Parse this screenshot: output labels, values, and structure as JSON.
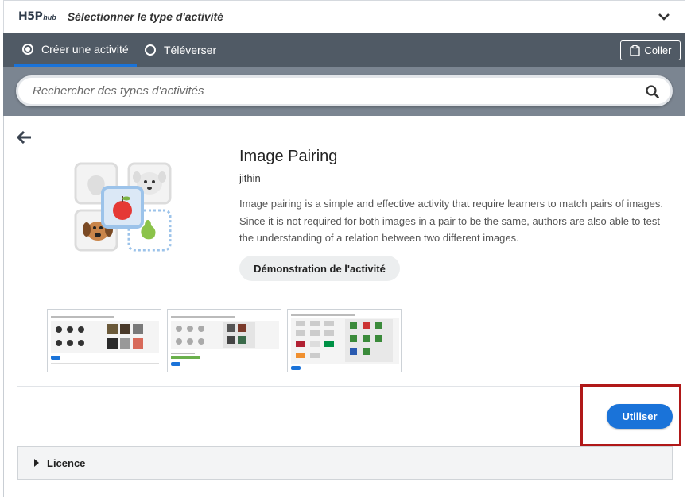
{
  "header": {
    "logo_main": "H5P",
    "logo_sub": "hub",
    "title": "Sélectionner le type d'activité"
  },
  "tabs": [
    {
      "label": "Créer une activité",
      "selected": true
    },
    {
      "label": "Téléverser",
      "selected": false
    }
  ],
  "paste_button": {
    "label": "Coller"
  },
  "search": {
    "placeholder": "Rechercher des types d'activités"
  },
  "activity": {
    "title": "Image Pairing",
    "owner": "jithin",
    "description": "Image pairing is a simple and effective activity that require learners to match pairs of images. Since it is not required for both images in a pair to be the same, authors are also able to test the understanding of a relation between two different images.",
    "demo_button": "Démonstration de l'activité",
    "use_button": "Utiliser"
  },
  "licence": {
    "label": "Licence"
  },
  "colors": {
    "accent": "#1a73d9",
    "tabs_bg": "#505a65",
    "search_bg": "#7b8591",
    "highlight": "#b01818"
  },
  "icons": [
    "h5p-logo",
    "chevron-down-icon",
    "radio-icon",
    "clipboard-icon",
    "search-icon",
    "back-arrow-icon",
    "caret-right-icon"
  ]
}
